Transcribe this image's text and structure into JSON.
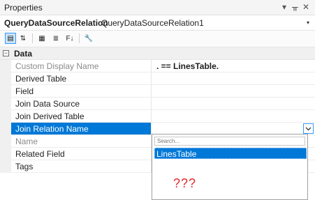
{
  "window": {
    "title": "Properties",
    "controls": {
      "dropdown_glyph": "▾",
      "pin_glyph": "ᚂ",
      "close_glyph": "✕"
    }
  },
  "object_selector": {
    "name": "QueryDataSourceRelation",
    "type": "QueryDataSourceRelation1",
    "arrow_glyph": "▾"
  },
  "toolbar": {
    "buttons": [
      {
        "name": "categorized-icon",
        "glyph": "▤",
        "active": true
      },
      {
        "name": "alphabetical-icon",
        "glyph": "⇅",
        "active": false
      },
      {
        "name": "properties-icon",
        "glyph": "▦",
        "active": false
      },
      {
        "name": "events-icon",
        "glyph": "≣",
        "active": false
      },
      {
        "name": "sort-icon",
        "glyph": "F↓",
        "active": false
      },
      {
        "name": "property-pages-icon",
        "glyph": "🔧",
        "active": false
      }
    ]
  },
  "grid": {
    "category": {
      "toggle": "−",
      "label": "Data"
    },
    "properties": [
      {
        "name": "Custom Display Name",
        "value": ". == LinesTable.",
        "readonly": true,
        "value_bold": true
      },
      {
        "name": "Derived Table",
        "value": "",
        "readonly": false
      },
      {
        "name": "Field",
        "value": "",
        "readonly": false
      },
      {
        "name": "Join Data Source",
        "value": "",
        "readonly": false
      },
      {
        "name": "Join Derived Table",
        "value": "",
        "readonly": false
      },
      {
        "name": "Join Relation Name",
        "value": "",
        "readonly": false,
        "selected": true
      },
      {
        "name": "Name",
        "value": "",
        "readonly": true
      },
      {
        "name": "Related Field",
        "value": "",
        "readonly": false
      },
      {
        "name": "Tags",
        "value": "",
        "readonly": false
      }
    ]
  },
  "dropdown": {
    "search_placeholder": "Search...",
    "options": [
      "LinesTable"
    ],
    "annotation": "???"
  },
  "colors": {
    "selection": "#0078d7",
    "annotation": "#e32b2b"
  }
}
